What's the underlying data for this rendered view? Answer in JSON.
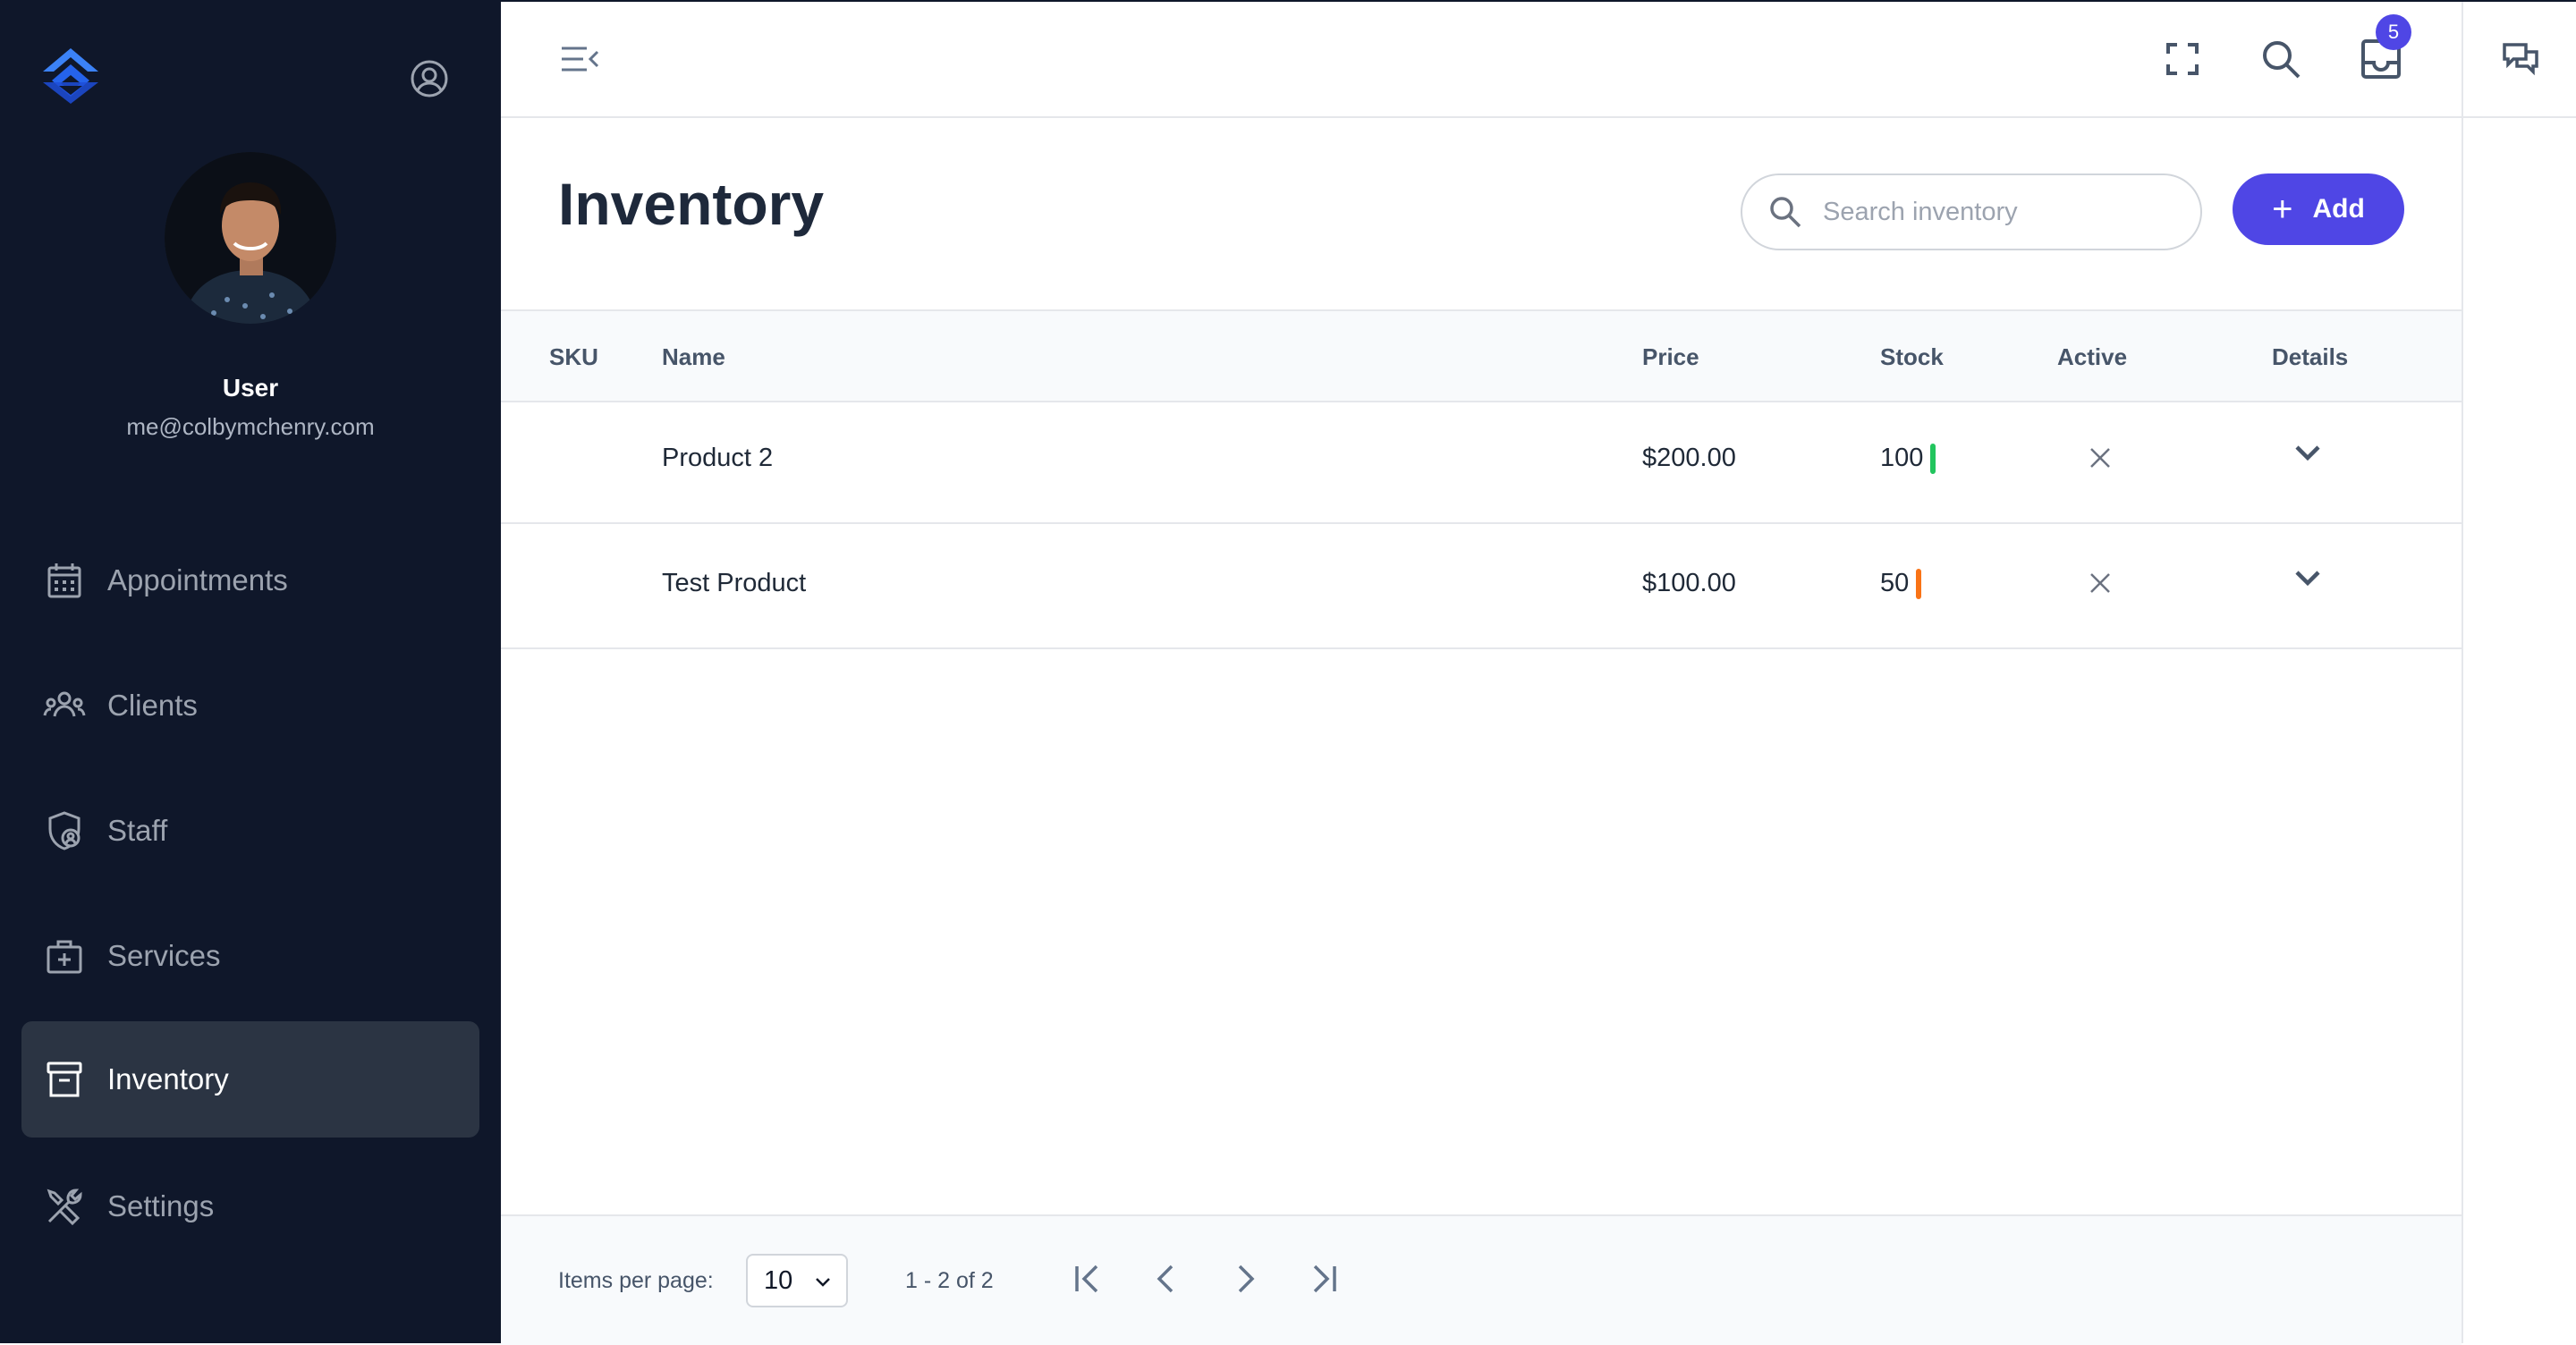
{
  "user": {
    "name": "User",
    "email": "me@colbymchenry.com"
  },
  "nav": [
    {
      "label": "Appointments",
      "icon": "calendar-icon"
    },
    {
      "label": "Clients",
      "icon": "users-icon"
    },
    {
      "label": "Staff",
      "icon": "shield-user-icon"
    },
    {
      "label": "Services",
      "icon": "medical-bag-icon"
    },
    {
      "label": "Inventory",
      "icon": "archive-box-icon",
      "active": true
    },
    {
      "label": "Settings",
      "icon": "tools-icon"
    }
  ],
  "topbar": {
    "notification_count": "5"
  },
  "page": {
    "title": "Inventory",
    "search_placeholder": "Search inventory",
    "add_label": "Add"
  },
  "table": {
    "columns": [
      "SKU",
      "Name",
      "Price",
      "Stock",
      "Active",
      "Details"
    ],
    "rows": [
      {
        "sku": "",
        "name": "Product 2",
        "price": "$200.00",
        "stock": "100",
        "stock_color": "#22c55e",
        "active": false
      },
      {
        "sku": "",
        "name": "Test Product",
        "price": "$100.00",
        "stock": "50",
        "stock_color": "#f97316",
        "active": false
      }
    ]
  },
  "paginator": {
    "items_per_page_label": "Items per page:",
    "items_per_page": "10",
    "range_label": "1 - 2 of 2"
  },
  "colors": {
    "sidebar_bg": "#0f172a",
    "accent": "#4f46e5"
  }
}
